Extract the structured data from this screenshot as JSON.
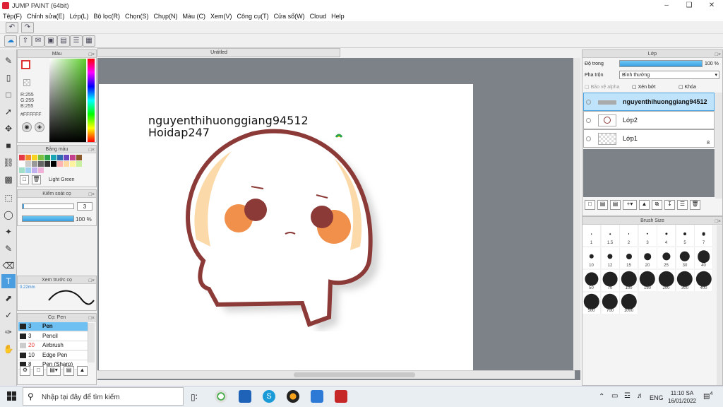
{
  "window": {
    "title": "JUMP PAINT (64bit)"
  },
  "menu": [
    "Tệp(F)",
    "Chỉnh sửa(E)",
    "Lớp(L)",
    "Bộ lọc(R)",
    "Chọn(S)",
    "Chụp(N)",
    "Màu (C)",
    "Xem(V)",
    "Công cụ(T)",
    "Cửa sổ(W)",
    "Cloud",
    "Help"
  ],
  "document": {
    "tab_title": "Untitled",
    "text_line1": "nguyenthihuonggiang94512",
    "text_line2": "Hoidap247"
  },
  "color_panel": {
    "title": "Màu",
    "r": "R:255",
    "g": "G:255",
    "b": "B:255",
    "hex": "#FFFFFF"
  },
  "palette_panel": {
    "title": "Bảng màu",
    "selected_name": "Light Green",
    "swatches": [
      "#e63946",
      "#f28c28",
      "#f7d21e",
      "#7ac143",
      "#2aa34a",
      "#1aa5b5",
      "#2b6cb0",
      "#6b46c1",
      "#c53f8c",
      "#8b5a2b",
      "#ffffff",
      "#cccccc",
      "#999999",
      "#666666",
      "#333333",
      "#000000",
      "#ffb3b3",
      "#ffd9a0",
      "#fff3a0",
      "#c8f0a0",
      "#a0e0c8",
      "#a0d0f0",
      "#c0b0f0",
      "#f0b0d8"
    ]
  },
  "brush_control": {
    "title": "Kiểm soát cọ",
    "size_value": "3",
    "opacity_value": "100 %"
  },
  "brush_preview": {
    "title": "Xem trước cọ",
    "size_label": "0.22mm"
  },
  "brush_list": {
    "title": "Cọ: Pen",
    "items": [
      {
        "size": "3",
        "name": "Pen",
        "selected": true,
        "color": "#222222"
      },
      {
        "size": "3",
        "name": "Pencil",
        "selected": false,
        "color": "#222222"
      },
      {
        "size": "20",
        "name": "Airbrush",
        "selected": false,
        "color": "#cccccc"
      },
      {
        "size": "10",
        "name": "Edge Pen",
        "selected": false,
        "color": "#222222"
      },
      {
        "size": "8",
        "name": "Pen (Sharp)",
        "selected": false,
        "color": "#222222"
      }
    ]
  },
  "layer_panel": {
    "title": "Lớp",
    "opacity_label": "Độ trong",
    "opacity_value": "100 %",
    "blend_label": "Pha trộn",
    "blend_value": "Bình thường",
    "protect_alpha": "Bảo vệ alpha",
    "clipping": "Xén bớt",
    "lock": "Khóa",
    "layers": [
      {
        "name": "nguyenthihuonggiang94512",
        "selected": true
      },
      {
        "name": "Lớp2",
        "selected": false
      },
      {
        "name": "Lớp1",
        "selected": false
      }
    ],
    "layer1_count": "8"
  },
  "brush_size_panel": {
    "title": "Brush Size",
    "sizes": [
      "1",
      "1.5",
      "2",
      "3",
      "4",
      "5",
      "7",
      "10",
      "12",
      "15",
      "20",
      "25",
      "30",
      "40",
      "50",
      "70",
      "100",
      "150",
      "200",
      "300",
      "400",
      "500",
      "700",
      "1000"
    ]
  },
  "taskbar": {
    "search_placeholder": "Nhập tại đây để tìm kiếm",
    "lang": "ENG",
    "time": "11:10 SA",
    "date": "16/01/2022",
    "notif_count": "4"
  }
}
